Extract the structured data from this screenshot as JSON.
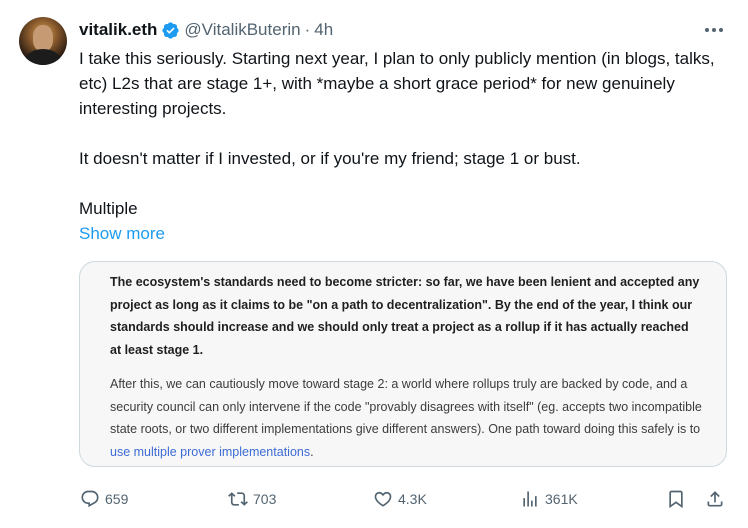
{
  "author": {
    "name": "vitalik.eth",
    "handle": "@VitalikButerin",
    "separator": "·",
    "time": "4h"
  },
  "tweet": {
    "paragraphs": [
      "I take this seriously. Starting next year, I plan to only publicly mention (in blogs, talks, etc) L2s that are stage 1+, with *maybe a short grace period* for new genuinely interesting projects.",
      "It doesn't matter if I invested, or if you're my friend; stage 1 or bust.",
      "Multiple"
    ],
    "show_more": "Show more"
  },
  "card": {
    "bold_text": "The ecosystem's standards need to become stricter: so far, we have been lenient and accepted any project as long as it claims to be \"on a path to decentralization\". By the end of the year, I think our standards should increase and we should only treat a project as a rollup if it has actually reached at least stage 1.",
    "normal_text": "After this, we can cautiously move toward stage 2: a world where rollups truly are backed by code, and a security council can only intervene if the code \"provably disagrees with itself\" (eg. accepts two incompatible state roots, or two different implementations give different answers). One path toward doing this safely is to ",
    "link_text": "use multiple prover implementations",
    "after_link": "."
  },
  "actions": {
    "replies": "659",
    "retweets": "703",
    "likes": "4.3K",
    "views": "361K"
  },
  "icons": {
    "verified": "verified-badge-icon",
    "more": "more-options-icon",
    "reply": "reply-icon",
    "retweet": "retweet-icon",
    "like": "heart-icon",
    "views": "views-icon",
    "bookmark": "bookmark-icon",
    "share": "share-icon"
  },
  "colors": {
    "accent": "#1d9bf0",
    "text": "#0f1419",
    "muted": "#536471",
    "card_link": "#3d6bd6"
  }
}
